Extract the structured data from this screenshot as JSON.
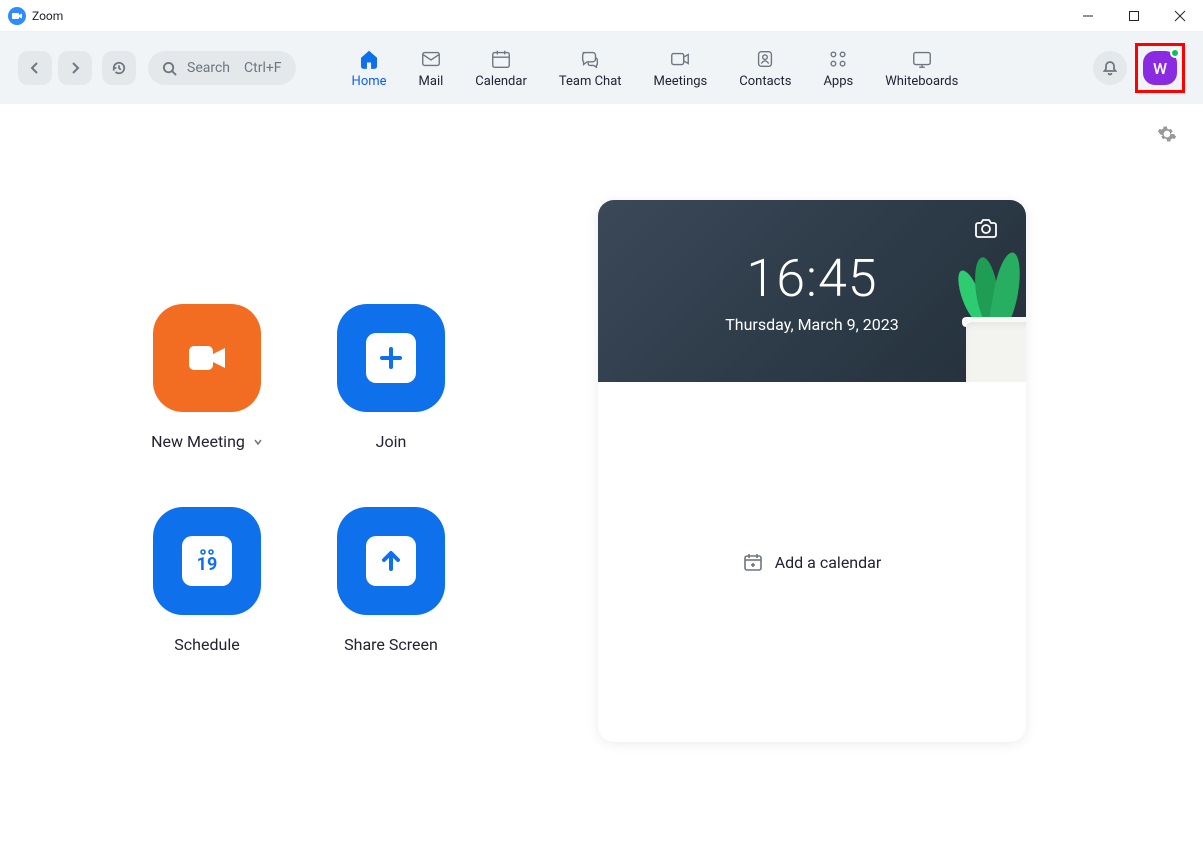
{
  "window": {
    "title": "Zoom"
  },
  "toolbar": {
    "search_label": "Search",
    "search_shortcut": "Ctrl+F",
    "nav": {
      "home": "Home",
      "mail": "Mail",
      "calendar": "Calendar",
      "teamchat": "Team Chat",
      "meetings": "Meetings",
      "contacts": "Contacts",
      "apps": "Apps",
      "whiteboards": "Whiteboards"
    },
    "avatar_initial": "W"
  },
  "actions": {
    "new_meeting": "New Meeting",
    "join": "Join",
    "schedule": "Schedule",
    "schedule_day": "19",
    "share_screen": "Share Screen"
  },
  "hero": {
    "time": "16:45",
    "date": "Thursday, March 9, 2023"
  },
  "calendar_cta": "Add a calendar"
}
